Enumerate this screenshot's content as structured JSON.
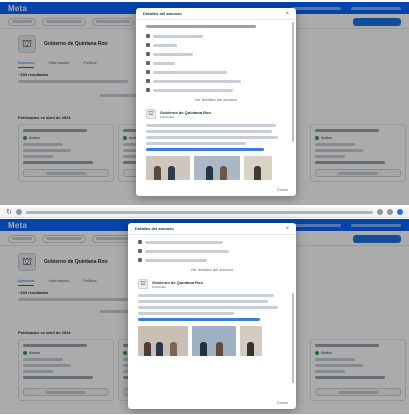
{
  "app": {
    "logo": "Meta"
  },
  "page": {
    "name": "Gobierno de Quintana Roo"
  },
  "tabs": [
    {
      "label": "Anuncios",
      "active": true
    },
    {
      "label": "Información",
      "active": false
    },
    {
      "label": "Política",
      "active": false
    }
  ],
  "results": {
    "count": "~100 resultados"
  },
  "section": {
    "published": "Publicados en abril de 2024"
  },
  "card": {
    "status": "Activo"
  },
  "modal": {
    "title": "Detalles del anuncio",
    "see_more": "Ver detalles del anuncio",
    "advertiser": "Gobierno de Quintana Roo",
    "advertiser_sub": "Publicidad",
    "close_label": "Cerrar",
    "close_glyph": "×"
  },
  "icons": {
    "page_avatar": "building-icon",
    "close": "close-icon",
    "flag": "flag-icon"
  },
  "colors": {
    "brand": "#0866ff",
    "active_status": "#31a24c",
    "overlay": "rgba(0,0,0,0.33)"
  }
}
